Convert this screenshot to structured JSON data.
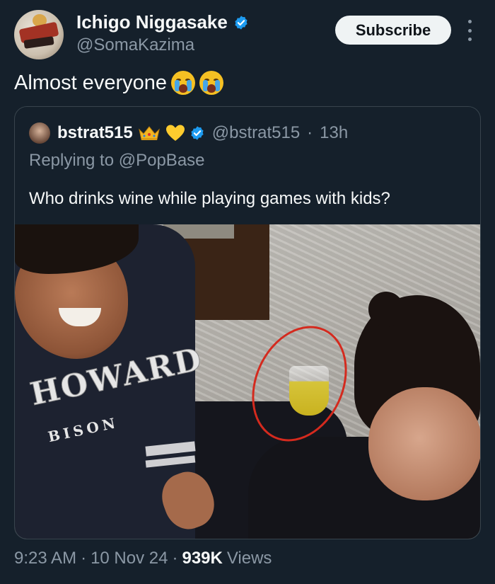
{
  "author": {
    "display_name": "Ichigo Niggasake",
    "handle": "@SomaKazima",
    "verified": true,
    "avatar_icon": "hollow-mask-avatar"
  },
  "actions": {
    "subscribe_label": "Subscribe",
    "more_icon": "more-vertical-icon"
  },
  "tweet": {
    "text": "Almost everyone",
    "emojis": [
      "loudly-crying-face",
      "loudly-crying-face"
    ]
  },
  "quoted_tweet": {
    "display_name": "bstrat515",
    "name_emojis": [
      "crown-icon",
      "yellow-heart-icon"
    ],
    "verified": true,
    "handle": "@bstrat515",
    "separator": "·",
    "time": "13h",
    "replying_to": "Replying to @PopBase",
    "text": "Who drinks wine while playing games with kids?",
    "photo": {
      "hoodie_line1": "HOWARD",
      "hoodie_line2": "BISON"
    }
  },
  "meta": {
    "time": "9:23 AM",
    "sep1": "·",
    "date": "10 Nov 24",
    "sep2": "·",
    "views_count": "939K",
    "views_label": "Views"
  },
  "colors": {
    "background": "#15202b",
    "verified_blue": "#1d9bf0",
    "secondary_text": "#8b98a5",
    "circle_red": "#d42a1e"
  }
}
